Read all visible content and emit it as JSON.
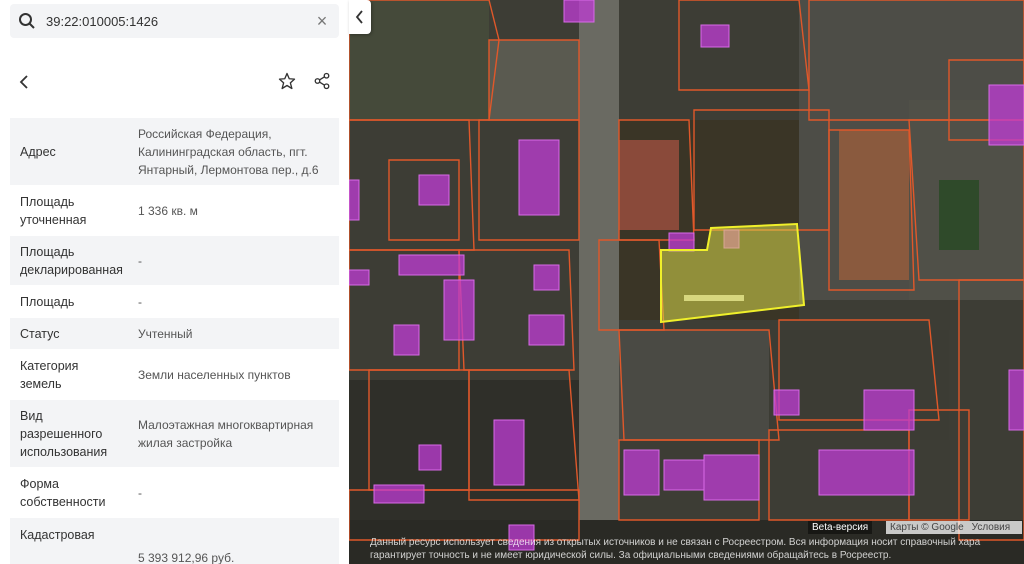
{
  "search": {
    "value": "39:22:010005:1426"
  },
  "icons": {
    "search": "search-icon",
    "clear": "close-icon",
    "back": "chevron-left-icon",
    "favorite": "star-icon",
    "share": "share-icon",
    "collapse": "chevron-left-icon"
  },
  "details": {
    "rows": [
      {
        "label": "Адрес",
        "value": "Российская Федерация, Калининградская область, пгт. Янтарный, Лермонтова пер., д.6"
      },
      {
        "label": "Площадь уточненная",
        "value": "1 336 кв. м"
      },
      {
        "label": "Площадь декларированная",
        "value": "-"
      },
      {
        "label": "Площадь",
        "value": "-"
      },
      {
        "label": "Статус",
        "value": "Учтенный"
      },
      {
        "label": "Категория земель",
        "value": "Земли населенных пунктов"
      },
      {
        "label": "Вид разрешенного использования",
        "value": "Малоэтажная многоквартирная жилая застройка"
      },
      {
        "label": "Форма собственности",
        "value": "-"
      },
      {
        "label": "Кадастровая",
        "value": "5 393 912,96 руб."
      }
    ]
  },
  "map": {
    "beta_label": "Beta-версия",
    "attribution_data": "Карты © Google",
    "attribution_terms": "Условия",
    "disclaimer_line1": "Данный ресурс использует сведения из открытых источников и не связан с Росреестром. Вся информация носит справочный хара",
    "disclaimer_line2": "гарантирует точность и не имеет юридической силы. За официальными сведениями обращайтесь в Росреестр.",
    "colors": {
      "parcel_outline": "#e0582a",
      "building_fill": "#c03cd6",
      "selected_fill": "#d8d84a",
      "selected_outline": "#f0f02a"
    }
  }
}
